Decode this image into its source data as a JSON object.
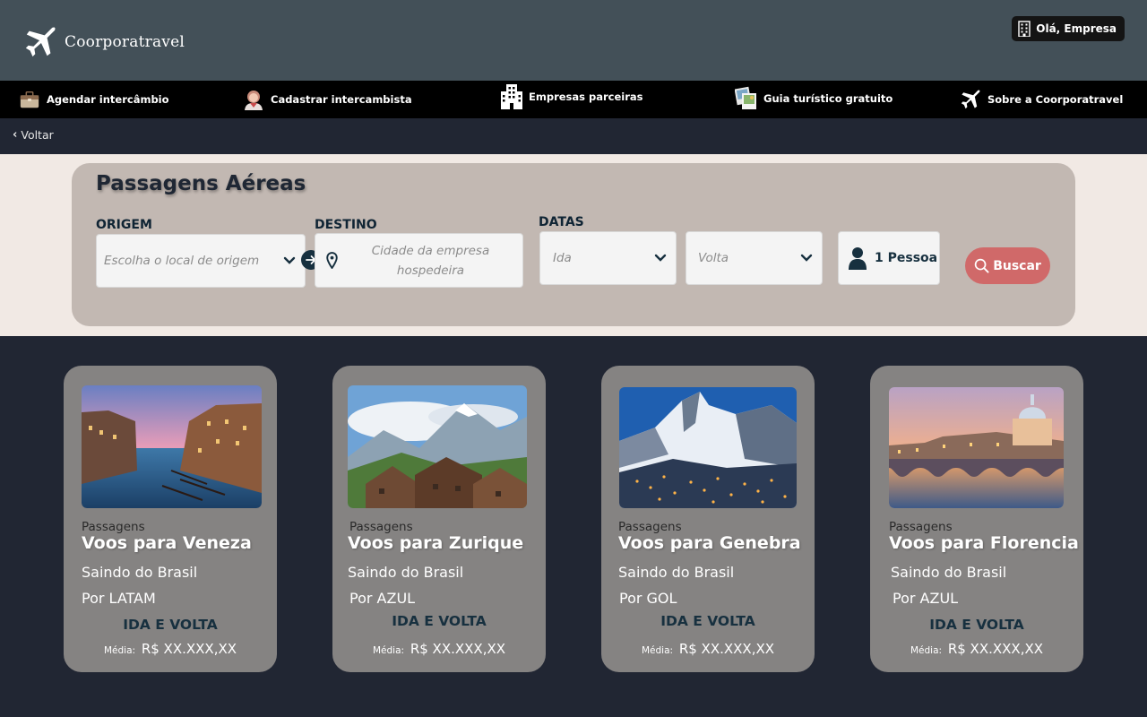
{
  "header": {
    "brand": "Coorporatravel",
    "user_label": "Olá, Empresa"
  },
  "nav": {
    "items": [
      {
        "label": "Agendar intercâmbio",
        "icon": "briefcase-icon"
      },
      {
        "label": "Cadastrar intercambista",
        "icon": "person-icon"
      },
      {
        "label": "Empresas parceiras",
        "icon": "building-icon"
      },
      {
        "label": "Guia turístico gratuito",
        "icon": "photos-icon"
      },
      {
        "label": "Sobre a Coorporatravel",
        "icon": "airplane-icon"
      }
    ]
  },
  "back": {
    "label": "Voltar"
  },
  "search": {
    "title": "Passagens Aéreas",
    "origin_label": "ORIGEM",
    "origin_placeholder": "Escolha o local de origem",
    "destination_label": "DESTINO",
    "destination_placeholder": "Cidade da empresa hospedeira",
    "dates_label": "DATAS",
    "ida_placeholder": "Ida",
    "volta_placeholder": "Volta",
    "people": "1 Pessoa",
    "search_button": "Buscar"
  },
  "cards": [
    {
      "kicker": "Passagens",
      "title": "Voos para Veneza",
      "line1": "Saindo do Brasil",
      "line2": "Por LATAM",
      "trip": "IDA E VOLTA",
      "price_label": "Média:",
      "price": "R$ XX.XXX,XX"
    },
    {
      "kicker": "Passagens",
      "title": "Voos para Zurique",
      "line1": "Saindo do Brasil",
      "line2": "Por AZUL",
      "trip": "IDA E VOLTA",
      "price_label": "Média:",
      "price": "R$ XX.XXX,XX"
    },
    {
      "kicker": "Passagens",
      "title": "Voos para Genebra",
      "line1": "Saindo do Brasil",
      "line2": "Por GOL",
      "trip": "IDA E VOLTA",
      "price_label": "Média:",
      "price": "R$ XX.XXX,XX"
    },
    {
      "kicker": "Passagens",
      "title": "Voos para Florencia",
      "line1": "Saindo do Brasil",
      "line2": "Por AZUL",
      "trip": "IDA E VOLTA",
      "price_label": "Média:",
      "price": "R$ XX.XXX,XX"
    }
  ],
  "colors": {
    "header_bg": "#435058",
    "nav_bg": "#000000",
    "page_bg": "#212633",
    "search_bg": "#f1e9e4",
    "panel_bg": "#c2b8b2",
    "card_bg": "#858382",
    "accent_button": "#d06969",
    "dark_text": "#17303f"
  }
}
